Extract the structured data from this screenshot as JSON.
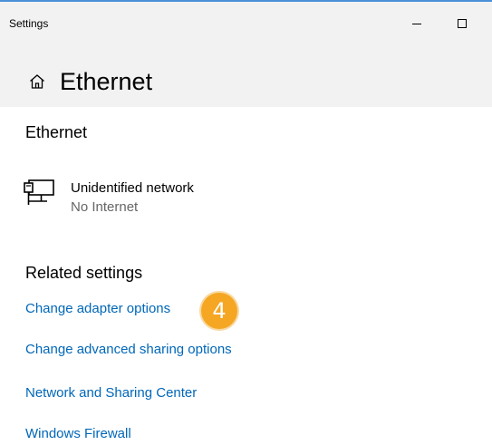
{
  "window": {
    "app_title": "Settings"
  },
  "header": {
    "page_title": "Ethernet",
    "home_icon": "home-icon"
  },
  "ethernet_section": {
    "heading": "Ethernet",
    "network": {
      "icon": "ethernet-icon",
      "name": "Unidentified network",
      "status": "No Internet"
    }
  },
  "related_settings": {
    "heading": "Related settings",
    "links": [
      "Change adapter options",
      "Change advanced sharing options",
      "Network and Sharing Center",
      "Windows Firewall"
    ]
  },
  "annotation": {
    "step": "4",
    "color": "#f5a623"
  },
  "colors": {
    "link": "#0067b8",
    "titlebar_bg": "#f2f2f2",
    "accent_border": "#4a90d9"
  }
}
